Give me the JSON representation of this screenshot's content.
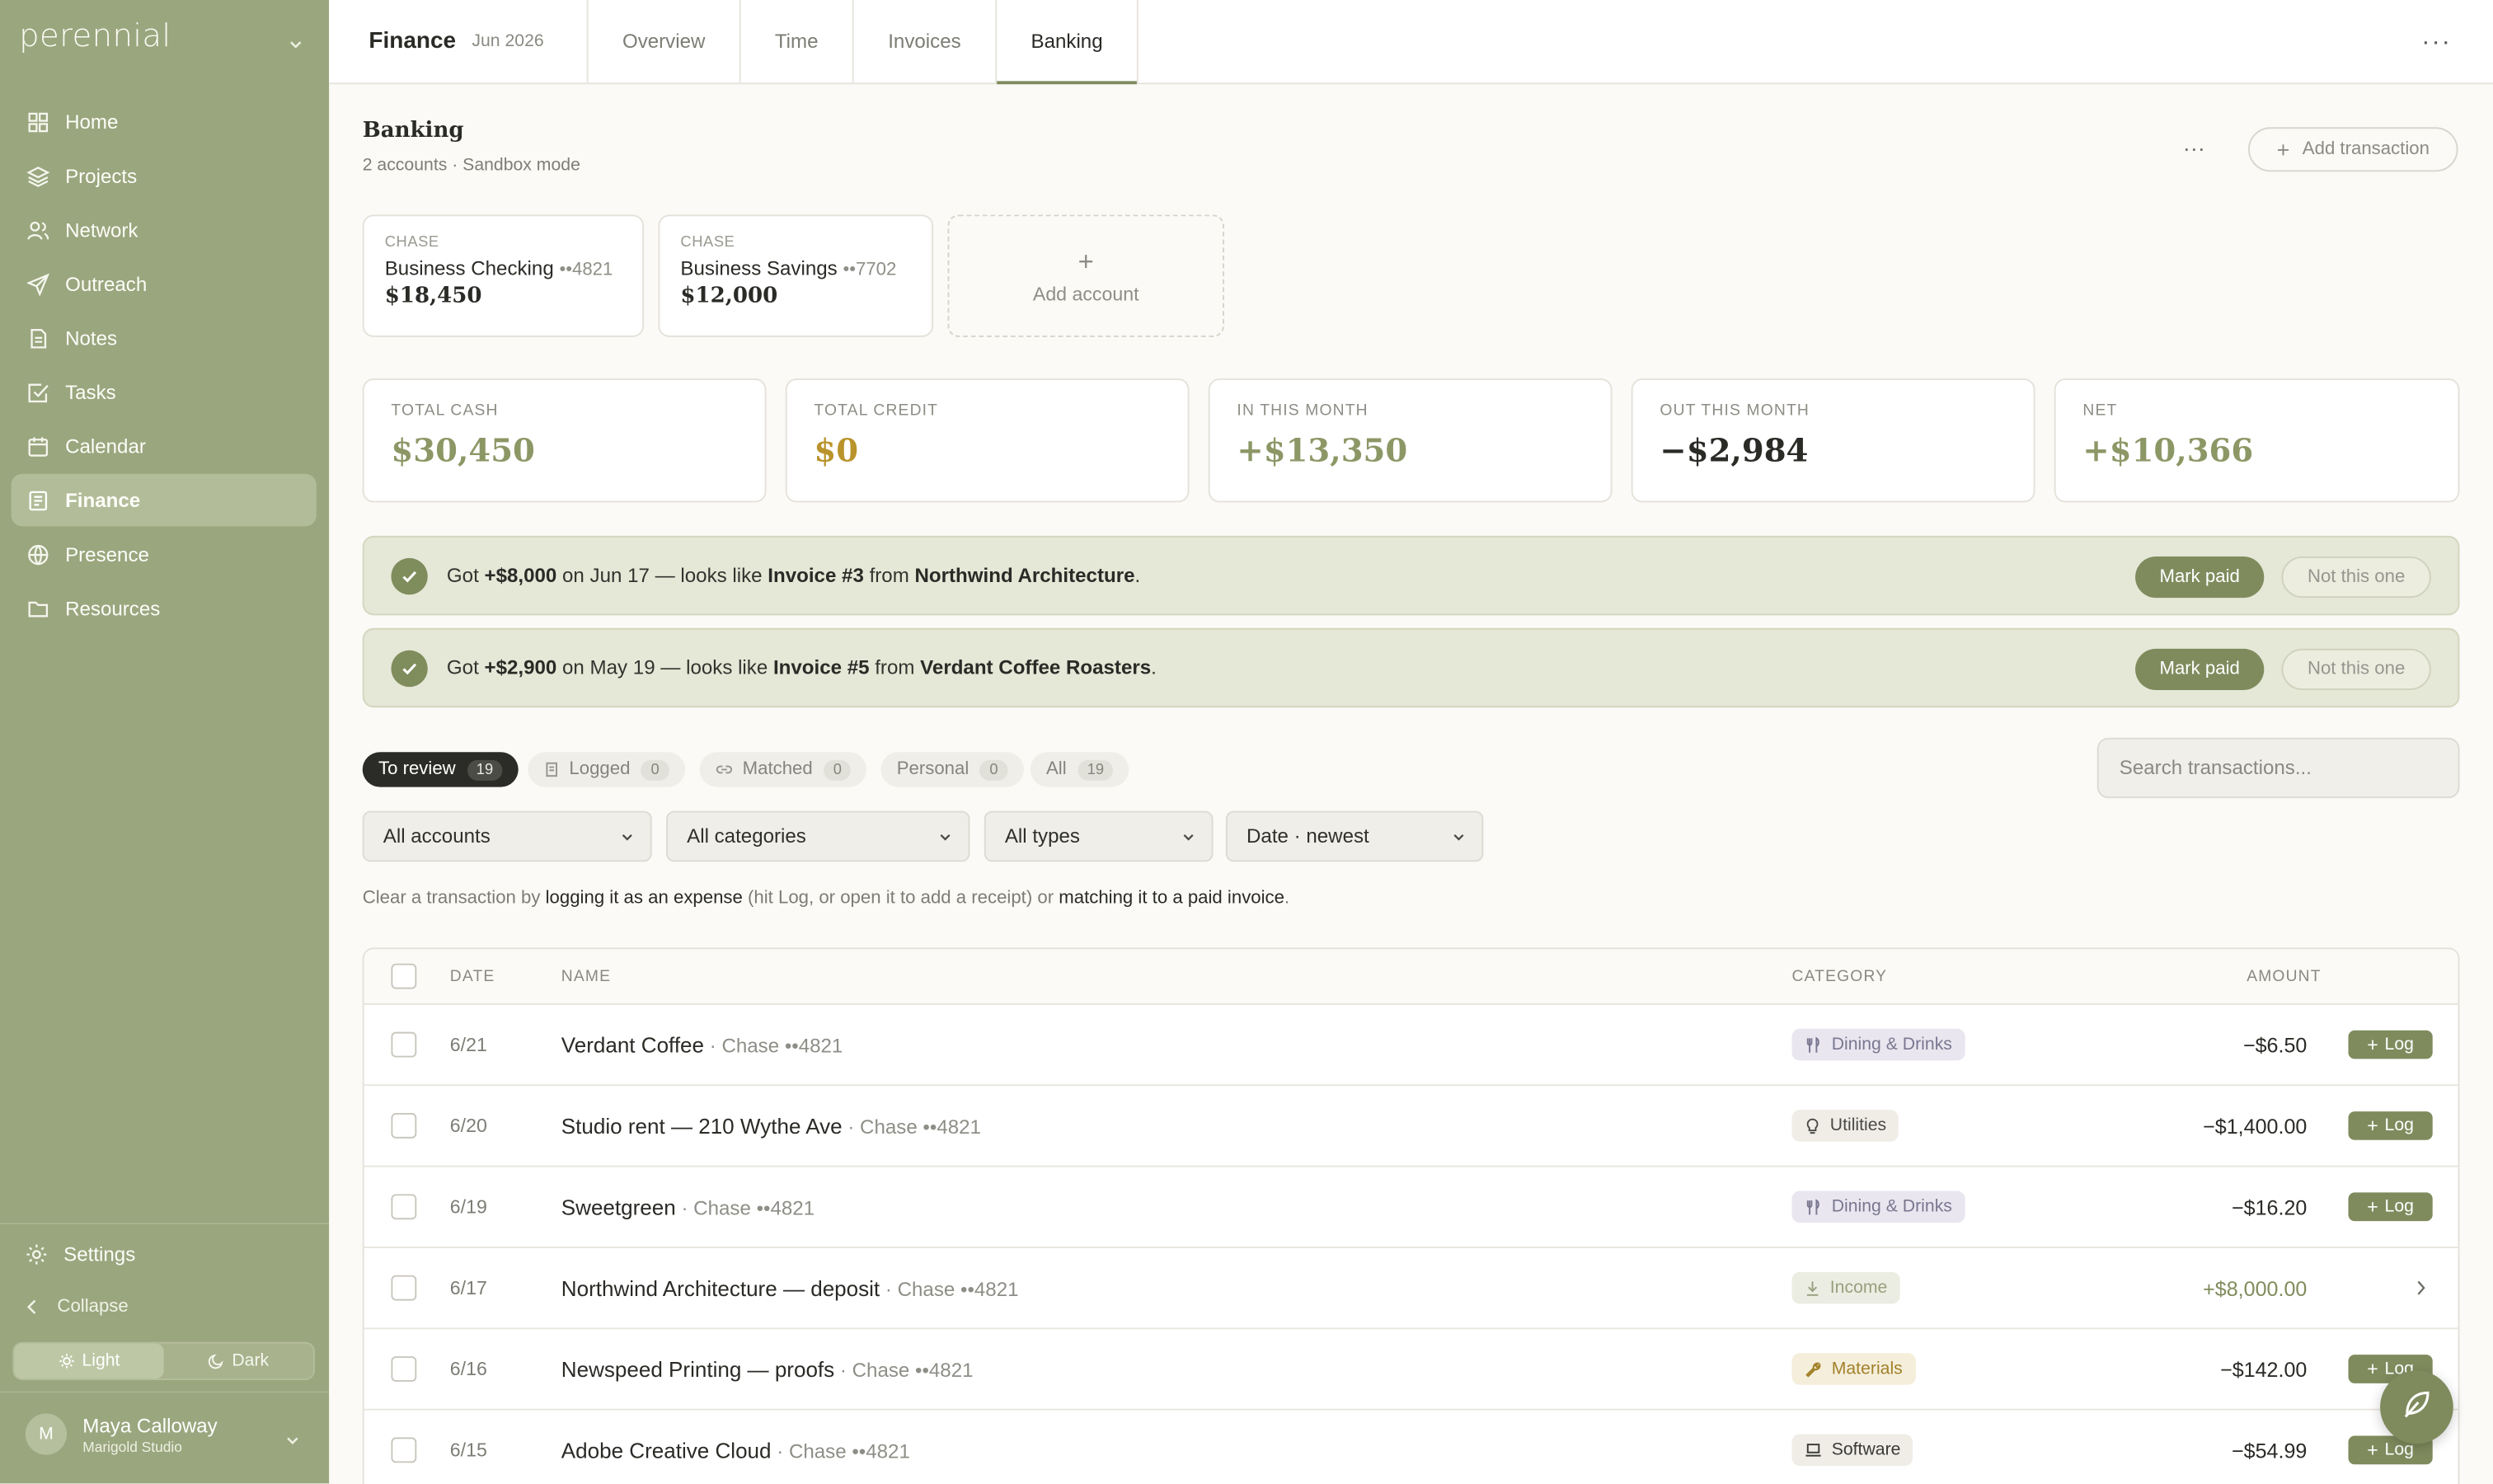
{
  "app": {
    "brand": "perennial"
  },
  "sidebar": {
    "items": [
      {
        "label": "Home",
        "icon": "grid-icon"
      },
      {
        "label": "Projects",
        "icon": "layers-icon"
      },
      {
        "label": "Network",
        "icon": "people-icon"
      },
      {
        "label": "Outreach",
        "icon": "send-icon"
      },
      {
        "label": "Notes",
        "icon": "note-icon"
      },
      {
        "label": "Tasks",
        "icon": "check-square-icon"
      },
      {
        "label": "Calendar",
        "icon": "calendar-icon"
      },
      {
        "label": "Finance",
        "icon": "ledger-icon",
        "active": true
      },
      {
        "label": "Presence",
        "icon": "globe-icon"
      },
      {
        "label": "Resources",
        "icon": "folder-icon"
      }
    ],
    "settings_label": "Settings",
    "collapse_label": "Collapse",
    "theme": {
      "light": "Light",
      "dark": "Dark",
      "selected": "Light"
    },
    "user": {
      "initial": "M",
      "name": "Maya Calloway",
      "org": "Marigold Studio"
    }
  },
  "topbar": {
    "title": "Finance",
    "date": "Jun 2026",
    "tabs": [
      "Overview",
      "Time",
      "Invoices",
      "Banking"
    ],
    "active_tab": "Banking"
  },
  "page": {
    "title": "Banking",
    "subtitle": "2 accounts · Sandbox mode",
    "add_transaction": "Add transaction"
  },
  "accounts": [
    {
      "bank": "CHASE",
      "name": "Business Checking",
      "mask": "••4821",
      "balance": "$18,450"
    },
    {
      "bank": "CHASE",
      "name": "Business Savings",
      "mask": "••7702",
      "balance": "$12,000"
    }
  ],
  "add_account_label": "Add account",
  "stats": [
    {
      "label": "TOTAL CASH",
      "value": "$30,450",
      "color": "#8c9766"
    },
    {
      "label": "TOTAL CREDIT",
      "value": "$0",
      "color": "#b9932b"
    },
    {
      "label": "IN THIS MONTH",
      "value": "+$13,350",
      "color": "#8c9766"
    },
    {
      "label": "OUT THIS MONTH",
      "value": "−$2,984",
      "color": "#2a2a26"
    },
    {
      "label": "NET",
      "value": "+$10,366",
      "color": "#8c9766"
    }
  ],
  "banners": [
    {
      "pre": "Got ",
      "amount": "+$8,000",
      "mid1": " on Jun 17 — looks like ",
      "invoice": "Invoice #3",
      "mid2": " from ",
      "client": "Northwind Architecture",
      "end": ".",
      "mark_paid": "Mark paid",
      "not_this": "Not this one"
    },
    {
      "pre": "Got ",
      "amount": "+$2,900",
      "mid1": " on May 19 — looks like ",
      "invoice": "Invoice #5",
      "mid2": " from ",
      "client": "Verdant Coffee Roasters",
      "end": ".",
      "mark_paid": "Mark paid",
      "not_this": "Not this one"
    }
  ],
  "filters": [
    {
      "label": "To review",
      "count": "19"
    },
    {
      "label": "Logged",
      "count": "0"
    },
    {
      "label": "Matched",
      "count": "0"
    },
    {
      "label": "Personal",
      "count": "0"
    },
    {
      "label": "All",
      "count": "19"
    }
  ],
  "search": {
    "placeholder": "Search transactions..."
  },
  "selects": {
    "accounts": "All accounts",
    "categories": "All categories",
    "types": "All types",
    "sort": "Date · newest"
  },
  "hint": {
    "pre": "Clear a transaction by ",
    "b1": "logging it as an expense",
    "mid": " (hit Log, or open it to add a receipt) or ",
    "b2": "matching it to a paid invoice",
    "end": "."
  },
  "table": {
    "headers": {
      "date": "DATE",
      "name": "NAME",
      "category": "CATEGORY",
      "amount": "AMOUNT"
    },
    "log_label": "Log",
    "rows": [
      {
        "date": "6/21",
        "name": "Verdant Coffee",
        "account": " · Chase ••4821",
        "category": "Dining & Drinks",
        "amount": "−$6.50"
      },
      {
        "date": "6/20",
        "name": "Studio rent — 210 Wythe Ave",
        "account": " · Chase ••4821",
        "category": "Utilities",
        "amount": "−$1,400.00"
      },
      {
        "date": "6/19",
        "name": "Sweetgreen",
        "account": " · Chase ••4821",
        "category": "Dining & Drinks",
        "amount": "−$16.20"
      },
      {
        "date": "6/17",
        "name": "Northwind Architecture — deposit",
        "account": " · Chase ••4821",
        "category": "Income",
        "amount": "+$8,000.00"
      },
      {
        "date": "6/16",
        "name": "Newspeed Printing — proofs",
        "account": " · Chase ••4821",
        "category": "Materials",
        "amount": "−$142.00"
      },
      {
        "date": "6/15",
        "name": "Adobe Creative Cloud",
        "account": " · Chase ••4821",
        "category": "Software",
        "amount": "−$54.99"
      }
    ]
  }
}
